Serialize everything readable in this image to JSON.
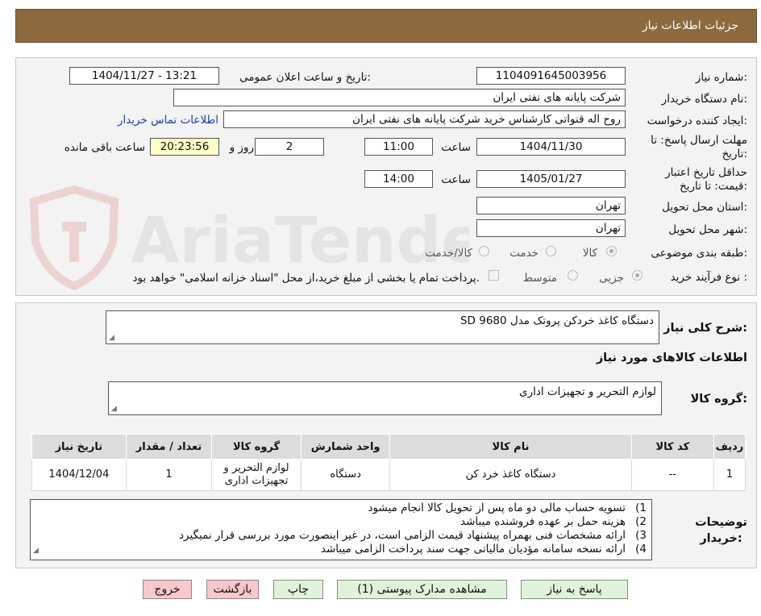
{
  "header": {
    "title": "جزئيات اطلاعات نياز"
  },
  "form": {
    "need_number_label": "شماره نیاز:",
    "need_number": "1104091645003956",
    "announce_label": "تاریخ و ساعت اعلان عمومی:",
    "announce_value": "1404/11/27 - 13:21",
    "buyer_org_label": "نام دستگاه خریدار:",
    "buyer_org": "شرکت پایانه های نفتی ایران",
    "creator_label": "ایجاد کننده درخواست:",
    "creator": "روح اله قنواتی کارشناس خرید شرکت پایانه های نفتی ایران",
    "contact_link": "اطلاعات تماس خریدار",
    "deadline_label": "مهلت ارسال پاسخ: تا تاریخ:",
    "deadline_date": "1404/11/30",
    "time_word": "ساعت",
    "deadline_time": "11:00",
    "days_value": "2",
    "days_word": "روز و",
    "remaining_time": "20:23:56",
    "remaining_word": "ساعت باقی مانده",
    "validity_label": "حداقل تاریخ اعتبار قیمت: تا تاریخ:",
    "validity_date": "1405/01/27",
    "validity_time": "14:00",
    "province_label": "استان محل تحویل:",
    "province": "تهران",
    "city_label": "شهر محل تحویل:",
    "city": "تهران",
    "category_label": "طبقه بندی موضوعی:",
    "category_options": [
      "کالا",
      "خدمت",
      "کالا/خدمت"
    ],
    "process_label": "نوع فرآیند خرید :",
    "process_options": [
      "جزیی",
      "متوسط"
    ],
    "process_note": "پرداخت تمام یا بخشی از مبلغ خرید،از محل \"اسناد خزانه اسلامی\" خواهد بود."
  },
  "details": {
    "summary_label": "شرح کلی نیاز:",
    "summary": "دستگاه کاغذ خردکن پروتک مدل SD 9680",
    "goods_info_title": "اطلاعات کالاهای مورد نیاز",
    "goods_group_label": "گروه کالا:",
    "goods_group": "لوازم التحریر و تجهیزات اداری"
  },
  "table": {
    "headers": [
      "ردیف",
      "کد کالا",
      "نام کالا",
      "واحد شمارش",
      "گروه کالا",
      "تعداد / مقدار",
      "تاریخ نیاز"
    ],
    "row": {
      "index": "1",
      "code": "--",
      "name": "دستگاه کاغذ خرد کن",
      "unit": "دستگاه",
      "group_line1": "لوازم التحریر و",
      "group_line2": "تجهیزات اداری",
      "qty": "1",
      "date": "1404/12/04"
    }
  },
  "notes": {
    "label_line1": "توضیحات",
    "label_line2": "خریدار:",
    "items": [
      {
        "n": "1)",
        "text": "تسویه حساب مالی دو ماه پس از تحویل کالا انجام میشود"
      },
      {
        "n": "2)",
        "text": "هزینه حمل بر عهده فروشنده میباشد"
      },
      {
        "n": "3)",
        "text": "ارائه مشخصات فنی بهمراه پیشنهاد قیمت الزامی است، در غیر اینصورت مورد بررسی قرار نمیگیرد"
      },
      {
        "n": "4)",
        "text": "ارائه نسخه سامانه مؤدیان مالیاتی جهت سند پرداخت الزامی میباشد"
      }
    ]
  },
  "buttons": {
    "reply": "پاسخ به نیاز",
    "attachments": "مشاهده مدارک پیوستی (1)",
    "print": "چاپ",
    "back": "بازگشت",
    "exit": "خروج"
  },
  "watermark": {
    "text": "AriaTender.neT"
  }
}
